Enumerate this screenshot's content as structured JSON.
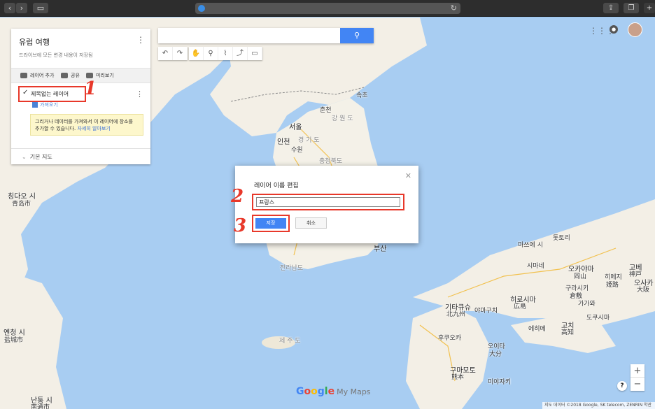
{
  "browser": {
    "back_icon": "chevron-left-icon",
    "forward_icon": "chevron-right-icon",
    "reload_icon": "reload-icon"
  },
  "panel": {
    "title": "유럽 여행",
    "subtitle": "드라이브에 모든 변경 내용이 저장됨",
    "actions": [
      {
        "label": "레이어 추가",
        "icon": "layers-icon"
      },
      {
        "label": "공유",
        "icon": "add-person-icon"
      },
      {
        "label": "미리보기",
        "icon": "eye-icon"
      }
    ],
    "layer_name": "제목없는 레이어",
    "import_label": "가져오기",
    "tip_text": "그리거나 데이터를 가져와서 이 레이어에 장소를 추가할 수 있습니다.",
    "tip_link": "자세히 알아보기",
    "basemap_label": "기본 지도"
  },
  "search": {
    "placeholder": "",
    "button_icon": "search-icon"
  },
  "toolbar": {
    "tools": [
      "undo-icon",
      "redo-icon",
      "hand-icon",
      "marker-icon",
      "line-icon",
      "directions-icon",
      "ruler-icon"
    ]
  },
  "dialog": {
    "title": "레이어 이름 편집",
    "input_value": "프랑스",
    "save_label": "저장",
    "cancel_label": "취소",
    "close_icon": "close-icon"
  },
  "annotations": {
    "one": "1",
    "two": "2",
    "three": "3"
  },
  "map": {
    "places": [
      {
        "id": "sokcho",
        "text": "속초"
      },
      {
        "id": "chuncheon",
        "text": "춘천"
      },
      {
        "id": "gangwon",
        "text": "강 원 도"
      },
      {
        "id": "seoul",
        "text": "서울"
      },
      {
        "id": "incheon",
        "text": "인천"
      },
      {
        "id": "suwon",
        "text": "수원"
      },
      {
        "id": "gyeonggi",
        "text": "경 기 도"
      },
      {
        "id": "chungbuk",
        "text": "충청북도"
      },
      {
        "id": "busan",
        "text": "부산"
      },
      {
        "id": "jeonnam",
        "text": "전라남도"
      },
      {
        "id": "jeju",
        "text": "제 주 도"
      },
      {
        "id": "qingdao",
        "text": "칭다오 시"
      },
      {
        "id": "qingdao_cn",
        "text": "青岛市"
      },
      {
        "id": "yancheng",
        "text": "옌청 시"
      },
      {
        "id": "yancheng_cn",
        "text": "盐城市"
      },
      {
        "id": "nantong",
        "text": "난퉁 시"
      },
      {
        "id": "nantong_cn",
        "text": "南通市"
      },
      {
        "id": "matsue",
        "text": "마쓰에 시"
      },
      {
        "id": "tottori",
        "text": "돗토리"
      },
      {
        "id": "okayama",
        "text": "오카야마"
      },
      {
        "id": "okayama_jp",
        "text": "岡山"
      },
      {
        "id": "kobe",
        "text": "고베"
      },
      {
        "id": "kobe_jp",
        "text": "神戸"
      },
      {
        "id": "osaka",
        "text": "오사카"
      },
      {
        "id": "osaka_jp",
        "text": "大阪"
      },
      {
        "id": "himeji",
        "text": "히메지"
      },
      {
        "id": "himeji_jp",
        "text": "姫路"
      },
      {
        "id": "hiroshima",
        "text": "히로시마"
      },
      {
        "id": "hiroshima_jp",
        "text": "広島"
      },
      {
        "id": "kurashiki",
        "text": "구라시키"
      },
      {
        "id": "kurashiki_jp",
        "text": "倉敷"
      },
      {
        "id": "kagawa",
        "text": "가가와"
      },
      {
        "id": "kochi",
        "text": "고치"
      },
      {
        "id": "kochi_jp",
        "text": "高知"
      },
      {
        "id": "kitakyushu",
        "text": "기타큐슈"
      },
      {
        "id": "kitakyushu_jp",
        "text": "北九州"
      },
      {
        "id": "fukuoka",
        "text": "후쿠오카"
      },
      {
        "id": "kumamoto",
        "text": "구마모토"
      },
      {
        "id": "kumamoto_jp",
        "text": "熊本"
      },
      {
        "id": "oita",
        "text": "오이타"
      },
      {
        "id": "oita_jp",
        "text": "大分"
      },
      {
        "id": "miyazaki",
        "text": "미야자키"
      },
      {
        "id": "yamaguchi",
        "text": "야마구치"
      },
      {
        "id": "ehime",
        "text": "에히메"
      },
      {
        "id": "tokushima",
        "text": "도쿠시마"
      },
      {
        "id": "shimane",
        "text": "시마네"
      }
    ]
  },
  "footer": {
    "logo_parts": [
      "G",
      "o",
      "o",
      "g",
      "l",
      "e"
    ],
    "logo_suffix": "My Maps",
    "copyright": "지도 데이터 ©2018 Google, SK telecom, ZENRIN   약관",
    "zoom_in": "+",
    "zoom_out": "−",
    "help": "?"
  }
}
